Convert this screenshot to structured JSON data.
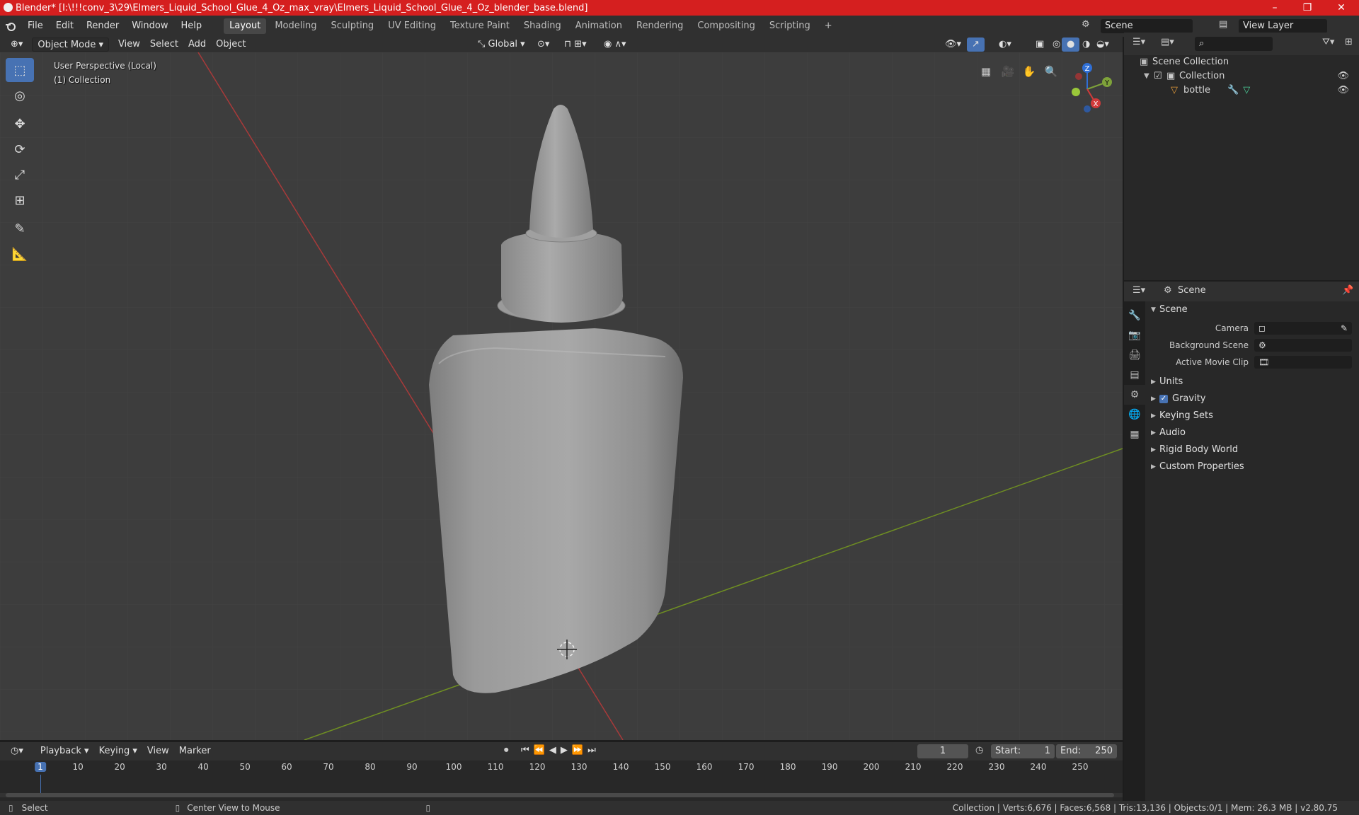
{
  "window": {
    "title": "Blender* [I:\\!!!conv_3\\29\\Elmers_Liquid_School_Glue_4_Oz_max_vray\\Elmers_Liquid_School_Glue_4_Oz_blender_base.blend]",
    "minimize": "–",
    "maximize": "❐",
    "close": "✕"
  },
  "menu": [
    "File",
    "Edit",
    "Render",
    "Window",
    "Help"
  ],
  "workspaces": [
    "Layout",
    "Modeling",
    "Sculpting",
    "UV Editing",
    "Texture Paint",
    "Shading",
    "Animation",
    "Rendering",
    "Compositing",
    "Scripting"
  ],
  "active_workspace": "Layout",
  "add_workspace": "+",
  "scene_field": "Scene",
  "view_layer_field": "View Layer",
  "viewport_header": {
    "mode": "Object Mode",
    "view": "View",
    "select": "Select",
    "add": "Add",
    "object": "Object",
    "orientation": "Global"
  },
  "viewport": {
    "perspective": "User Perspective (Local)",
    "collection": "(1) Collection",
    "gizmo": {
      "x": "X",
      "y": "Y",
      "z": "Z"
    }
  },
  "tools": [
    "select-box",
    "cursor",
    "move",
    "rotate",
    "scale",
    "transform",
    "annotate",
    "measure"
  ],
  "outliner": {
    "root": "Scene Collection",
    "collection": "Collection",
    "object": "bottle"
  },
  "properties": {
    "header": "Scene",
    "panel": "Scene",
    "fields": [
      {
        "label": "Camera",
        "value": ""
      },
      {
        "label": "Background Scene",
        "value": ""
      },
      {
        "label": "Active Movie Clip",
        "value": ""
      }
    ],
    "subpanels": [
      "Units",
      "Gravity",
      "Keying Sets",
      "Audio",
      "Rigid Body World",
      "Custom Properties"
    ],
    "gravity_checked": true
  },
  "timeline": {
    "menus": [
      "Playback",
      "Keying",
      "View",
      "Marker"
    ],
    "current_frame": "1",
    "start_label": "Start:",
    "start": "1",
    "end_label": "End:",
    "end": "250",
    "ticks": [
      "1",
      "10",
      "20",
      "30",
      "40",
      "50",
      "60",
      "70",
      "80",
      "90",
      "100",
      "110",
      "120",
      "130",
      "140",
      "150",
      "160",
      "170",
      "180",
      "190",
      "200",
      "210",
      "220",
      "230",
      "240",
      "250"
    ]
  },
  "status": {
    "select": "Select",
    "center": "Center View to Mouse",
    "stats": "Collection | Verts:6,676 | Faces:6,568 | Tris:13,136 | Objects:0/1 | Mem: 26.3 MB | v2.80.75"
  }
}
